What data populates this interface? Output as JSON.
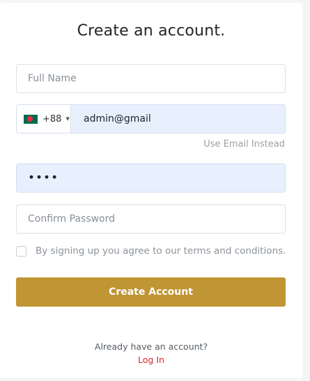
{
  "form": {
    "title": "Create an account.",
    "full_name_placeholder": "Full Name",
    "phone": {
      "country_flag": "bangladesh-flag",
      "dial_code": "+88",
      "value": "admin@gmail"
    },
    "use_email_link": "Use Email Instead",
    "password_value": "••••",
    "confirm_password_placeholder": "Confirm Password",
    "terms_text": "By signing up you agree to our terms and conditions.",
    "submit_label": "Create Account",
    "already_text": "Already have an account?",
    "login_link": "Log In"
  },
  "colors": {
    "accent": "#c09533",
    "link_red": "#d7262e",
    "autofill_bg": "#e8f0fe"
  }
}
